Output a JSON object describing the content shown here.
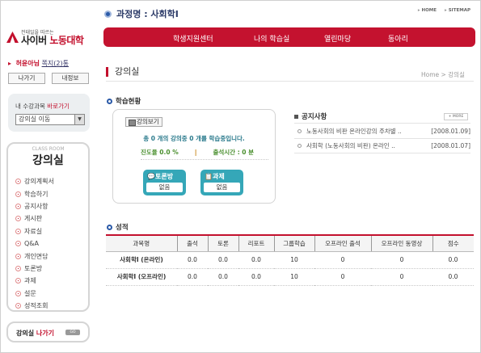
{
  "header": {
    "logo_tagline": "전태일을 따르는",
    "logo_prefix": "사이버 ",
    "logo_main": "노동대학",
    "course_label": "과정명 : 사회학I",
    "home_link": "HOME",
    "sitemap_link": "SITEMAP"
  },
  "gnb": [
    "학생지원센터",
    "나의 학습실",
    "열린마당",
    "동아리"
  ],
  "user": {
    "name": "허윤아님",
    "mail": "쪽지(2)통",
    "logout_label": "나가기",
    "info_label": "내정보"
  },
  "quick": {
    "title_prefix": "내 수강과목 ",
    "title_accent": "바로가기",
    "selected": "강의실 이동"
  },
  "side": {
    "en_title": "CLASS ROOM",
    "ko_title": "강의실",
    "items": [
      "강의계획서",
      "학습하기",
      "공지사항",
      "게시판",
      "자료실",
      "Q&A",
      "개인면담",
      "토론방",
      "과제",
      "설문",
      "성적조회"
    ]
  },
  "exit": {
    "label_prefix": "강의실 ",
    "label_accent": "나가기",
    "go": "GO"
  },
  "page": {
    "title": "강의실",
    "breadcrumb": "Home  >  강의실"
  },
  "study": {
    "section_title": "학습현황",
    "view_button": "강의보기",
    "summary": "총 0 개의 강의중 0 개를 학습중입니다.",
    "progress": "진도율 0.0 %",
    "sep": "|",
    "attendance": "출석시간 : 0 분",
    "discussion_label": "토론방",
    "discussion_value": "없음",
    "assignment_label": "과제",
    "assignment_value": "없음"
  },
  "notice": {
    "title": "공지사항",
    "more": "MORE",
    "items": [
      {
        "title": "노동사회의 비판 온라인강의 주차별 ..",
        "date": "[2008.01.09]"
      },
      {
        "title": "사회학 (노동사회의 비판) 온라인 ..",
        "date": "[2008.01.07]"
      }
    ]
  },
  "grades": {
    "section_title": "성적",
    "headers": [
      "과목명",
      "출석",
      "토론",
      "리포트",
      "그룹학습",
      "오프라인 출석",
      "오프라인 동영상",
      "점수"
    ],
    "rows": [
      [
        "사회학I (온라인)",
        "0.0",
        "0.0",
        "0.0",
        "10",
        "0",
        "0",
        "0.0"
      ],
      [
        "사회학I (오프라인)",
        "0.0",
        "0.0",
        "0.0",
        "10",
        "0",
        "0",
        "0.0"
      ]
    ]
  },
  "colors": {
    "accent": "#c4122f",
    "teal": "#35a7b8",
    "link": "#2b5aa8"
  }
}
